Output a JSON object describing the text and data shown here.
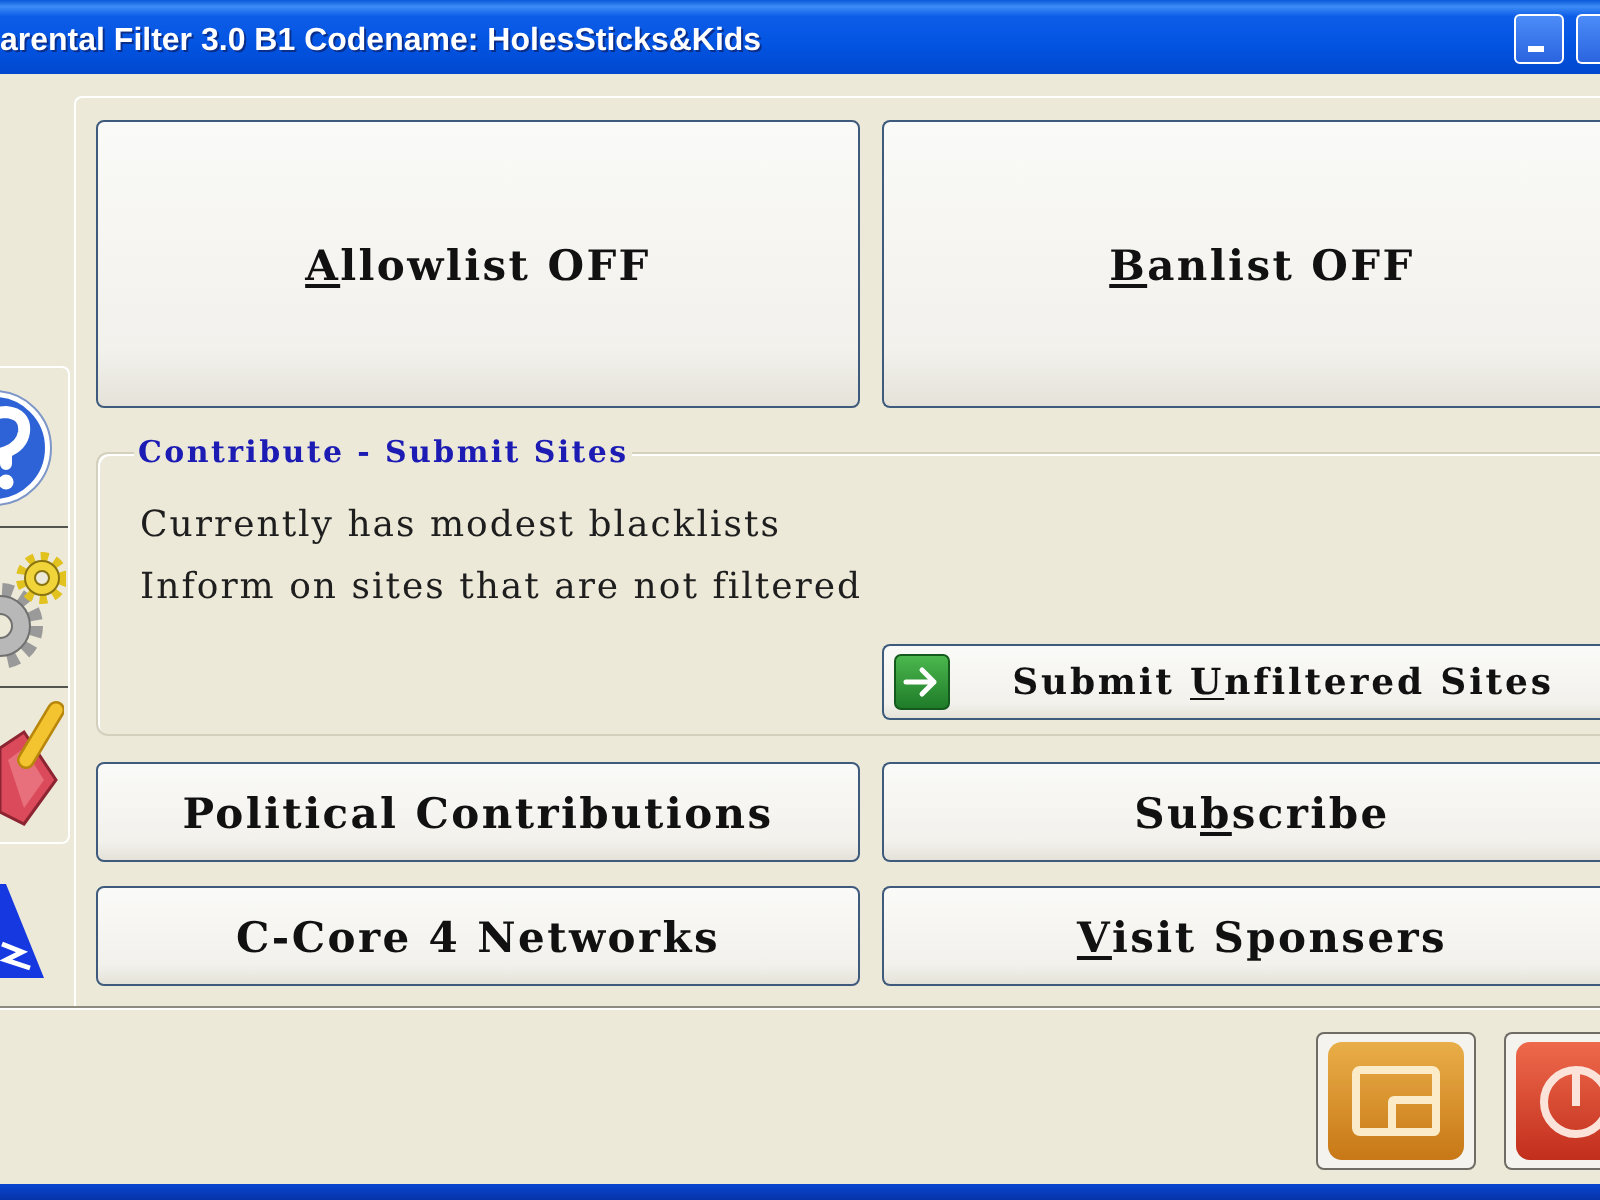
{
  "window": {
    "title": "arental Filter 3.0 B1 Codename: HolesSticks&Kids"
  },
  "toggles": [
    {
      "parts": [
        {
          "text": "A",
          "underline": true
        },
        {
          "text": "llowlist OFF",
          "underline": false
        }
      ]
    },
    {
      "parts": [
        {
          "text": "B",
          "underline": true
        },
        {
          "text": "anlist OFF",
          "underline": false
        }
      ]
    }
  ],
  "contribute": {
    "title": "Contribute - Submit Sites",
    "lines": [
      "Currently has modest blacklists",
      "Inform on sites that are not filtered"
    ],
    "button": {
      "parts": [
        {
          "text": "Submit ",
          "underline": false
        },
        {
          "text": "U",
          "underline": true
        },
        {
          "text": "nfiltered Sites",
          "underline": false
        }
      ]
    }
  },
  "buttons": [
    {
      "parts": [
        {
          "text": "Political Contributions",
          "underline": false
        }
      ]
    },
    {
      "parts": [
        {
          "text": "Su",
          "underline": false
        },
        {
          "text": "b",
          "underline": true
        },
        {
          "text": "scribe",
          "underline": false
        }
      ]
    },
    {
      "parts": [
        {
          "text": "C-Core 4 Networks",
          "underline": false
        }
      ]
    },
    {
      "parts": [
        {
          "text": "V",
          "underline": true
        },
        {
          "text": "isit Sponsers",
          "underline": false
        }
      ]
    }
  ]
}
